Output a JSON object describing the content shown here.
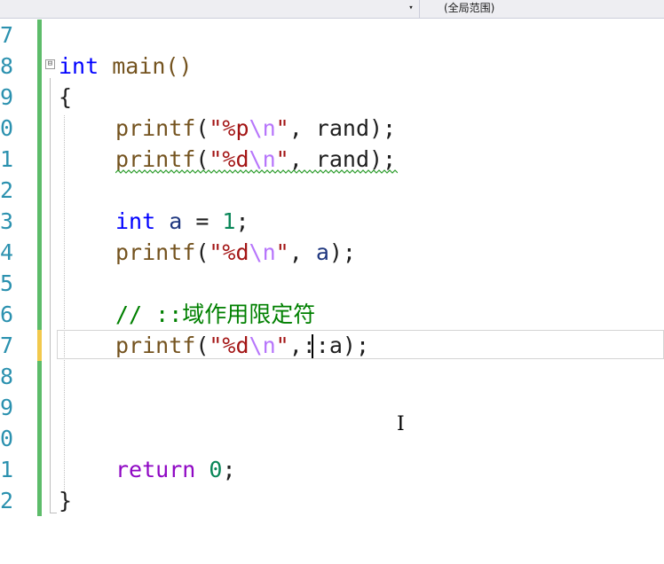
{
  "toolbar": {
    "dropdown_arrow": "▾",
    "scope_label": "(全局范围)"
  },
  "colors": {
    "keyword": "#0000ff",
    "control_keyword": "#8f08c4",
    "function": "#74531f",
    "string": "#a31515",
    "escape": "#b776fb",
    "comment": "#008000",
    "line_number": "#2b91af",
    "change_saved": "#5dbc6a",
    "change_unsaved": "#f2c94c"
  },
  "editor": {
    "line_numbers": [
      "7",
      "8",
      "9",
      "0",
      "1",
      "2",
      "3",
      "4",
      "5",
      "6",
      "7",
      "8",
      "9",
      "0",
      "1",
      "2"
    ],
    "fold_marker": "⊟",
    "lines": {
      "l8": {
        "kw": "int",
        "rest": " main()"
      },
      "l9": {
        "text": "{"
      },
      "l10": {
        "fn": "printf",
        "open": "(",
        "q1": "\"%p",
        "esc": "\\n",
        "q2": "\"",
        "rest": ", rand);"
      },
      "l11": {
        "fn": "printf",
        "open": "(",
        "q1": "\"%d",
        "esc": "\\n",
        "q2": "\"",
        "rest": ", rand);"
      },
      "l13": {
        "kw": "int",
        "var": " a",
        "rest": " = ",
        "num": "1",
        "end": ";"
      },
      "l14": {
        "fn": "printf",
        "open": "(",
        "q1": "\"%d",
        "esc": "\\n",
        "q2": "\"",
        "rest": ", ",
        "var": "a",
        "end": ");"
      },
      "l16": {
        "comment": "// ::域作用限定符"
      },
      "l17": {
        "fn": "printf",
        "open": "(",
        "q1": "\"%d",
        "esc": "\\n",
        "q2": "\"",
        "rest": ",::a);"
      },
      "l21": {
        "kw": "return",
        "rest": " ",
        "num": "0",
        "end": ";"
      },
      "l22": {
        "text": "}"
      }
    }
  }
}
